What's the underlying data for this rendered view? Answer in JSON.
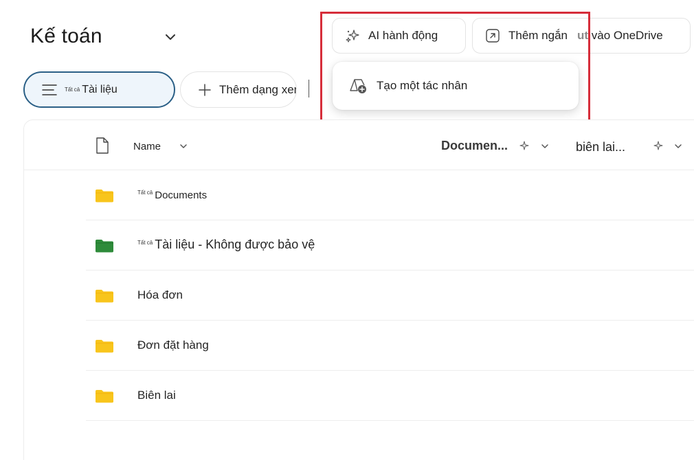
{
  "header": {
    "title": "Kế toán"
  },
  "toolbar": {
    "ai_actions_label": "AI hành động",
    "add_shortcut_label": "Thêm ngắn",
    "add_shortcut_ghost": "ut",
    "add_shortcut_suffix": "vào OneDrive"
  },
  "ai_menu": {
    "create_agent_label": "Tạo một tác nhân"
  },
  "views": {
    "current_prefix": "Tất cả",
    "current_label": "Tài liệu",
    "add_view_label": "Thêm dạng xem"
  },
  "table": {
    "columns": {
      "name": "Name",
      "documents": "Documen...",
      "receipts": "biên lai..."
    },
    "rows": [
      {
        "prefix": "Tất cả",
        "name": "Documents",
        "icon": "folder-yellow"
      },
      {
        "prefix": "Tất cả",
        "name": "Tài liệu - Không được bảo vệ",
        "icon": "folder-green"
      },
      {
        "prefix": "",
        "name": "Hóa đơn",
        "icon": "folder-yellow"
      },
      {
        "prefix": "",
        "name": "Đơn đặt hàng",
        "icon": "folder-yellow"
      },
      {
        "prefix": "",
        "name": "Biên lai",
        "icon": "folder-yellow"
      }
    ]
  },
  "colors": {
    "highlight": "#d62d3a",
    "folder_yellow": "#f8c51c",
    "folder_green": "#2e8b3a",
    "pill_border": "#2a5f86"
  }
}
